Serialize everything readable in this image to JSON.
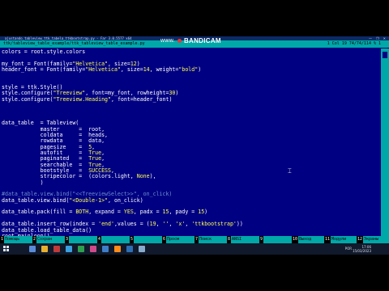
{
  "window": {
    "title": "ajustando_tableview_ttk_tabela_ttkbootstrap.py - Far 3.0.5577 x64",
    "controls": [
      "—",
      "❐",
      "✕"
    ]
  },
  "editor_bar": {
    "file": "ttk/tableview_table_example/ttk_tableview_table_example.py",
    "position": "1 Col 19 74/74/114 %  1"
  },
  "recorder": {
    "name": "BANDICAM",
    "url": "www."
  },
  "code_lines": [
    "colors = root.style.colors",
    "",
    "my_font = Font(family=\"Helvetica\", size=12)",
    "header_font = Font(family=\"Helvetica\", size=14, weight=\"bold\")",
    "",
    "",
    "style = ttk.Style()",
    "style.configure(\"Treeview\", font=my_font, rowheight=30)",
    "style.configure(\"Treeview.Heading\", font=header_font)",
    "",
    "",
    "",
    "data_table  = Tableview(",
    "            master      =  root,",
    "            coldata     =  heads,",
    "            rowdata     =  data,",
    "            pagesize    =  5,",
    "            autofit     =  True,",
    "            paginated   =  True,",
    "            searchable  =  True,",
    "            bootstyle   =  SUCCESS,",
    "            stripecolor =  (colors.light, None),",
    "            )",
    "",
    "#data_table.view.bind(\"<<TreeviewSelect>>\", on_click)",
    "data_table.view.bind(\"<Double-1>\", on_click)",
    "",
    "data_table.pack(fill = BOTH, expand = YES, padx = 15, pady = 15)",
    "",
    "data_table.insert_row(index = 'end',values = (19, '', 'x', 'ttkbootstrap'))",
    "data_table.load_table_data()",
    "root.mainloop()"
  ],
  "function_keys": [
    {
      "n": "1",
      "label": "Помощь"
    },
    {
      "n": "2",
      "label": "Сохран"
    },
    {
      "n": "3",
      "label": ""
    },
    {
      "n": "4",
      "label": ""
    },
    {
      "n": "5",
      "label": ""
    },
    {
      "n": "6",
      "label": "Просм"
    },
    {
      "n": "7",
      "label": "Поиск"
    },
    {
      "n": "8",
      "label": "ANSI"
    },
    {
      "n": "9",
      "label": ""
    },
    {
      "n": "10",
      "label": "Выход"
    },
    {
      "n": "11",
      "label": "Модули"
    },
    {
      "n": "12",
      "label": "Экраны"
    }
  ],
  "taskbar": {
    "icon_colors": [
      "#5b8bd8",
      "#e8b030",
      "#c03a3a",
      "#3aa0e0",
      "#2f9f4f",
      "#d04a8a",
      "#3e7ec8",
      "#ff8c1a",
      "#2d6fb3",
      "#8ac"
    ],
    "lang": "POR",
    "time": "17:06",
    "date": "15/03/2023"
  },
  "colors": {
    "editor_bg": "#000082",
    "bar_bg": "#00a8a8",
    "string": "#ffff54",
    "text": "#ffffff"
  }
}
